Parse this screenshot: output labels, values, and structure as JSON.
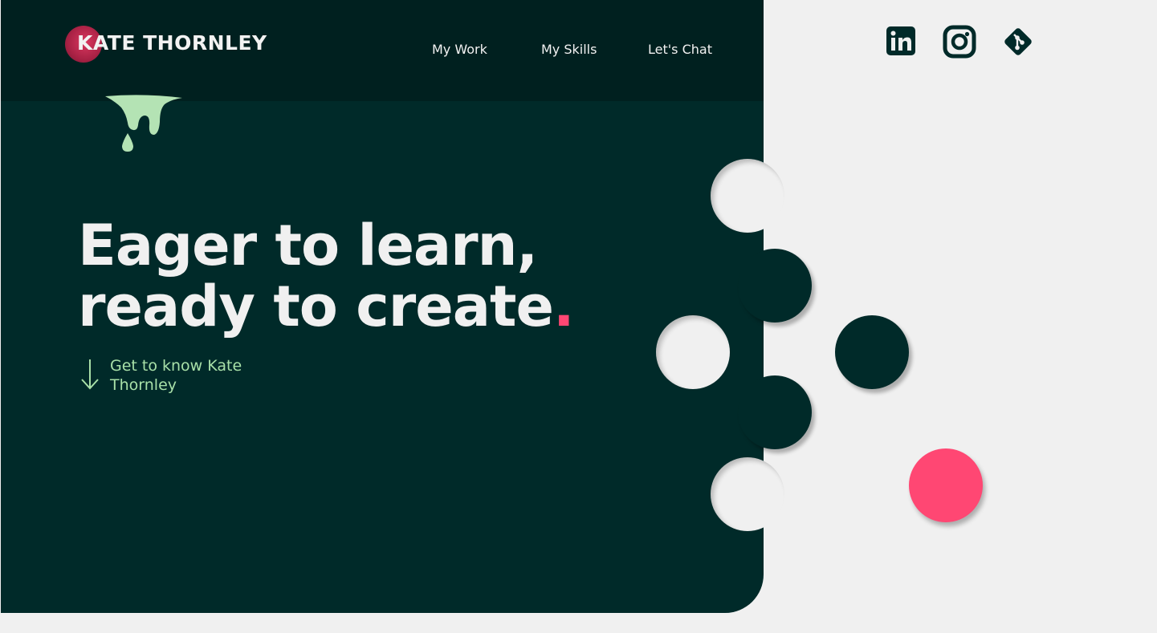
{
  "brand": {
    "name": "KATE THORNLEY"
  },
  "nav": {
    "items": [
      "My Work",
      "My Skills",
      "Let's Chat"
    ]
  },
  "hero": {
    "headline_line1": "Eager to learn,",
    "headline_line2": "ready to create",
    "headline_end": ".",
    "cta": "Get to know Kate Thornley"
  },
  "social": {
    "icons": [
      "linkedin-icon",
      "instagram-icon",
      "git-icon"
    ]
  },
  "colors": {
    "dark_green": "#002a29",
    "header_green": "#00201f",
    "accent_pink": "#ff4773",
    "mint": "#a8e0a8",
    "background": "#f0f0f0"
  }
}
